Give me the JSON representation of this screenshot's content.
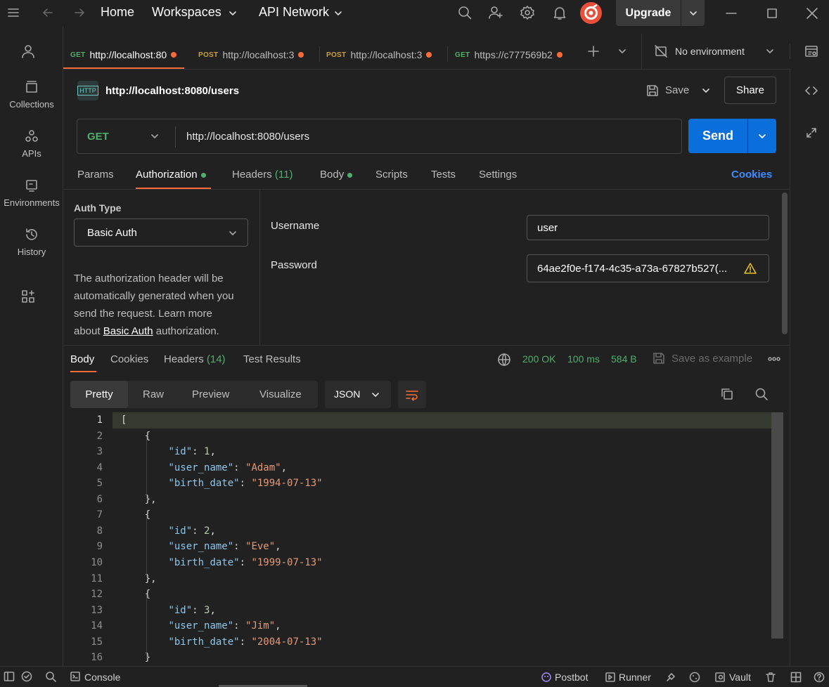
{
  "topbar": {
    "nav": [
      "Home",
      "Workspaces",
      "API Network"
    ],
    "upgrade_label": "Upgrade"
  },
  "sidebar": {
    "items": [
      {
        "label": "Collections",
        "icon": "collections-icon"
      },
      {
        "label": "APIs",
        "icon": "apis-icon"
      },
      {
        "label": "Environments",
        "icon": "environments-icon"
      },
      {
        "label": "History",
        "icon": "history-icon"
      }
    ]
  },
  "tabs": [
    {
      "method": "GET",
      "title": "http://localhost:80"
    },
    {
      "method": "POST",
      "title": "http://localhost:3"
    },
    {
      "method": "POST",
      "title": "http://localhost:3"
    },
    {
      "method": "GET",
      "title": "https://c777569b2"
    }
  ],
  "environment": {
    "label": "No environment"
  },
  "request": {
    "title": "http://localhost:8080/users",
    "save_label": "Save",
    "share_label": "Share",
    "method": "GET",
    "url": "http://localhost:8080/users",
    "send_label": "Send",
    "http_badge": "HTTP"
  },
  "request_tabs": {
    "params": "Params",
    "authorization": "Authorization",
    "headers": "Headers",
    "headers_count": "(11)",
    "body": "Body",
    "scripts": "Scripts",
    "tests": "Tests",
    "settings": "Settings",
    "cookies": "Cookies"
  },
  "auth": {
    "type_label": "Auth Type",
    "type_value": "Basic Auth",
    "help_1": "The authorization header will be",
    "help_2": "automatically generated when you",
    "help_3": "send the request. Learn more",
    "help_4a": "about ",
    "help_link": "Basic Auth",
    "help_4b": " authorization.",
    "username_label": "Username",
    "username_value": "user",
    "password_label": "Password",
    "password_value": "64ae2f0e-f174-4c35-a73a-67827b527(..."
  },
  "response_tabs": {
    "body": "Body",
    "cookies": "Cookies",
    "headers": "Headers",
    "headers_count": "(14)",
    "test_results": "Test Results"
  },
  "response_status": {
    "status": "200 OK",
    "time": "100 ms",
    "size": "584 B",
    "save_example": "Save as example"
  },
  "view_tabs": {
    "pretty": "Pretty",
    "raw": "Raw",
    "preview": "Preview",
    "visualize": "Visualize",
    "format": "JSON"
  },
  "code_lines": [
    {
      "n": "1"
    },
    {
      "n": "2"
    },
    {
      "n": "3"
    },
    {
      "n": "4"
    },
    {
      "n": "5"
    },
    {
      "n": "6"
    },
    {
      "n": "7"
    },
    {
      "n": "8"
    },
    {
      "n": "9"
    },
    {
      "n": "10"
    },
    {
      "n": "11"
    },
    {
      "n": "12"
    },
    {
      "n": "13"
    },
    {
      "n": "14"
    },
    {
      "n": "15"
    },
    {
      "n": "16"
    }
  ],
  "users": [
    {
      "id": "1",
      "user_name": "\"Adam\"",
      "birth_date": "\"1994-07-13\""
    },
    {
      "id": "2",
      "user_name": "\"Eve\"",
      "birth_date": "\"1999-07-13\""
    },
    {
      "id": "3",
      "user_name": "\"Jim\"",
      "birth_date": "\"2004-07-13\""
    }
  ],
  "json_keys": {
    "id": "\"id\"",
    "user_name": "\"user_name\"",
    "birth_date": "\"birth_date\""
  },
  "footer": {
    "console": "Console",
    "postbot": "Postbot",
    "runner": "Runner",
    "vault": "Vault"
  },
  "colors": {
    "accent_orange": "#ff6c37",
    "send_blue": "#0b6fdb",
    "ok_green": "#4fae6f",
    "link_blue": "#3d8dff"
  }
}
